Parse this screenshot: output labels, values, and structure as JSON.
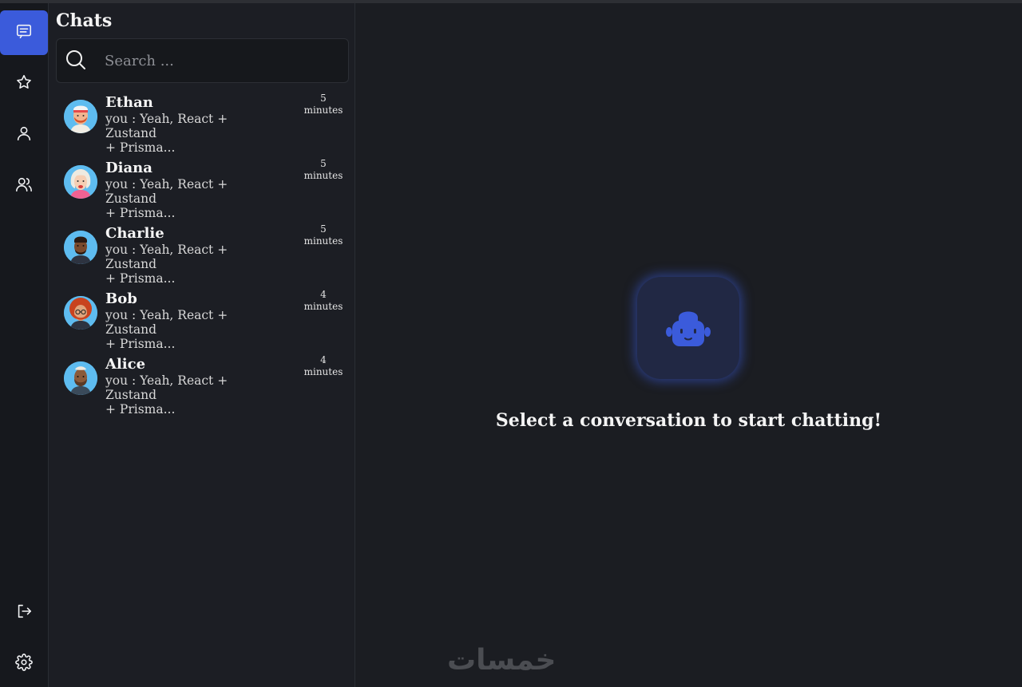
{
  "sidebar": {
    "items": [
      {
        "name": "chats",
        "icon": "message-square-icon",
        "active": true
      },
      {
        "name": "favorites",
        "icon": "star-icon",
        "active": false
      },
      {
        "name": "profile",
        "icon": "user-icon",
        "active": false
      },
      {
        "name": "groups",
        "icon": "users-icon",
        "active": false
      }
    ],
    "bottom": [
      {
        "name": "logout",
        "icon": "logout-icon"
      },
      {
        "name": "settings",
        "icon": "gear-icon"
      }
    ],
    "accent_color": "#3b5bdb"
  },
  "chat_panel": {
    "title": "Chats",
    "search_placeholder": "Search ...",
    "conversations": [
      {
        "name": "Ethan",
        "preview_line1": "you : Yeah, React + Zustand",
        "preview_line2": "+ Prisma...",
        "time_value": "5",
        "time_unit": "minutes"
      },
      {
        "name": "Diana",
        "preview_line1": "you : Yeah, React + Zustand",
        "preview_line2": "+ Prisma...",
        "time_value": "5",
        "time_unit": "minutes"
      },
      {
        "name": "Charlie",
        "preview_line1": "you : Yeah, React + Zustand",
        "preview_line2": "+ Prisma...",
        "time_value": "5",
        "time_unit": "minutes"
      },
      {
        "name": "Bob",
        "preview_line1": "you : Yeah, React + Zustand",
        "preview_line2": "+ Prisma...",
        "time_value": "4",
        "time_unit": "minutes"
      },
      {
        "name": "Alice",
        "preview_line1": "you : Yeah, React + Zustand",
        "preview_line2": "+ Prisma...",
        "time_value": "4",
        "time_unit": "minutes"
      }
    ]
  },
  "main": {
    "empty_icon": "bot-icon",
    "empty_message": "Select a conversation to start chatting!"
  },
  "watermark": {
    "text": "خمسات"
  }
}
